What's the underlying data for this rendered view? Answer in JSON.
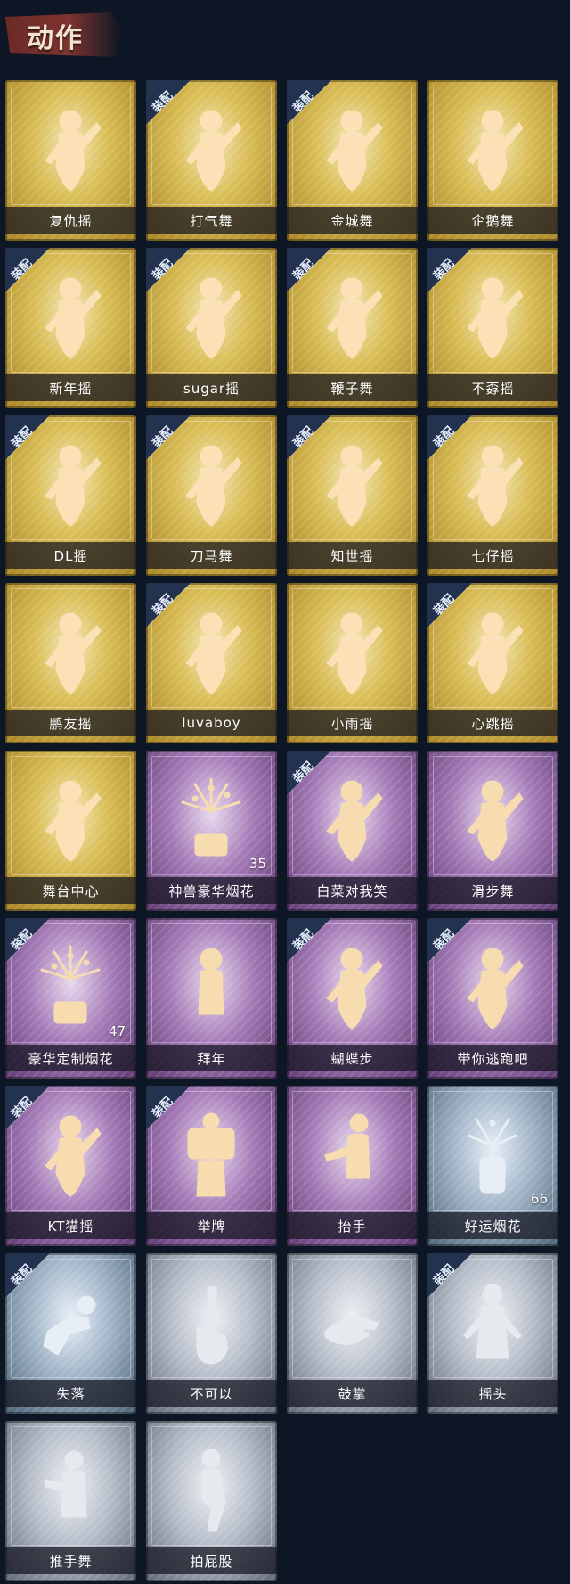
{
  "header": {
    "title": "动作"
  },
  "equip_label": "装配",
  "colors": {
    "gold": "#d9bd55",
    "purple": "#a57bb7",
    "silver": "#b5bcc8",
    "blue": "#9fb2c6",
    "background": "#0d1624",
    "header_banner": "#7e3430"
  },
  "items": [
    {
      "name": "复仇摇",
      "rarity": "gold",
      "equipped": false,
      "icon": "dance-figure-icon"
    },
    {
      "name": "打气舞",
      "rarity": "gold",
      "equipped": true,
      "icon": "dance-figure-icon"
    },
    {
      "name": "金城舞",
      "rarity": "gold",
      "equipped": true,
      "icon": "dance-figure-icon"
    },
    {
      "name": "企鹅舞",
      "rarity": "gold",
      "equipped": false,
      "icon": "dance-figure-icon"
    },
    {
      "name": "新年摇",
      "rarity": "gold",
      "equipped": true,
      "icon": "dance-figure-icon"
    },
    {
      "name": "sugar摇",
      "rarity": "gold",
      "equipped": true,
      "icon": "dance-figure-icon"
    },
    {
      "name": "鞭子舞",
      "rarity": "gold",
      "equipped": true,
      "icon": "dance-figure-icon"
    },
    {
      "name": "不孬摇",
      "rarity": "gold",
      "equipped": true,
      "icon": "dance-figure-icon"
    },
    {
      "name": "DL摇",
      "rarity": "gold",
      "equipped": true,
      "icon": "dance-figure-icon"
    },
    {
      "name": "刀马舞",
      "rarity": "gold",
      "equipped": true,
      "icon": "dance-figure-icon"
    },
    {
      "name": "知世摇",
      "rarity": "gold",
      "equipped": true,
      "icon": "dance-figure-icon"
    },
    {
      "name": "七仔摇",
      "rarity": "gold",
      "equipped": true,
      "icon": "dance-figure-icon"
    },
    {
      "name": "鹏友摇",
      "rarity": "gold",
      "equipped": false,
      "icon": "dance-figure-icon"
    },
    {
      "name": "luvaboy",
      "rarity": "gold",
      "equipped": true,
      "icon": "dance-figure-icon"
    },
    {
      "name": "小雨摇",
      "rarity": "gold",
      "equipped": false,
      "icon": "dance-figure-icon"
    },
    {
      "name": "心跳摇",
      "rarity": "gold",
      "equipped": true,
      "icon": "dance-figure-icon"
    },
    {
      "name": "舞台中心",
      "rarity": "gold",
      "equipped": false,
      "icon": "dance-figure-icon"
    },
    {
      "name": "神兽豪华烟花",
      "rarity": "purple",
      "equipped": false,
      "icon": "fireworks-icon",
      "count": "35"
    },
    {
      "name": "白菜对我笑",
      "rarity": "purple",
      "equipped": true,
      "icon": "dance-figure-icon"
    },
    {
      "name": "滑步舞",
      "rarity": "purple",
      "equipped": false,
      "icon": "dance-figure-icon"
    },
    {
      "name": "豪华定制烟花",
      "rarity": "purple",
      "equipped": true,
      "icon": "fireworks-icon",
      "count": "47"
    },
    {
      "name": "拜年",
      "rarity": "purple",
      "equipped": false,
      "icon": "bow-figure-icon"
    },
    {
      "name": "蝴蝶步",
      "rarity": "purple",
      "equipped": true,
      "icon": "dance-figure-icon"
    },
    {
      "name": "带你逃跑吧",
      "rarity": "purple",
      "equipped": true,
      "icon": "dance-figure-icon"
    },
    {
      "name": "KT猫摇",
      "rarity": "purple",
      "equipped": true,
      "icon": "dance-figure-icon"
    },
    {
      "name": "举牌",
      "rarity": "purple",
      "equipped": true,
      "icon": "sign-figure-icon"
    },
    {
      "name": "抬手",
      "rarity": "purple",
      "equipped": false,
      "icon": "raise-hand-figure-icon"
    },
    {
      "name": "好运烟花",
      "rarity": "blue",
      "equipped": false,
      "icon": "firework-can-icon",
      "count": "66"
    },
    {
      "name": "失落",
      "rarity": "blue",
      "equipped": true,
      "icon": "crawl-figure-icon"
    },
    {
      "name": "不可以",
      "rarity": "silver",
      "equipped": false,
      "icon": "finger-wag-icon"
    },
    {
      "name": "鼓掌",
      "rarity": "silver",
      "equipped": false,
      "icon": "clap-hands-icon"
    },
    {
      "name": "摇头",
      "rarity": "silver",
      "equipped": true,
      "icon": "shake-head-figure-icon"
    },
    {
      "name": "推手舞",
      "rarity": "silver",
      "equipped": false,
      "icon": "push-hand-figure-icon"
    },
    {
      "name": "拍屁股",
      "rarity": "silver",
      "equipped": false,
      "icon": "slap-figure-icon"
    }
  ]
}
